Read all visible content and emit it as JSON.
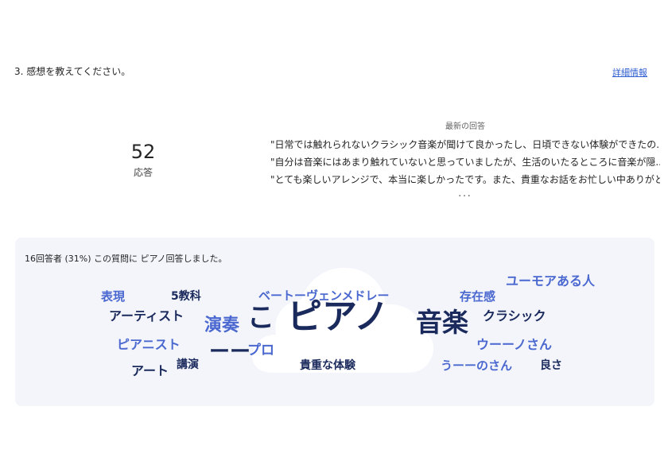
{
  "question": {
    "title": "3. 感想を教えてください。",
    "details_link": "詳細情報"
  },
  "summary": {
    "count": "52",
    "label": "応答"
  },
  "latest": {
    "heading": "最新の回答",
    "responses": [
      "\"日常では触れられないクラシック音楽が聞けて良かったし、日頃できない体験ができたの...\"",
      "\"自分は音楽にはあまり触れていないと思っていましたが、生活のいたるところに音楽が隠...\"",
      "\"とても楽しいアレンジで、本当に楽しかったです。また、貴重なお話をお忙しい中ありがと...\""
    ],
    "more": "..."
  },
  "word_cloud": {
    "caption": "16回答者 (31%) この質問に ピアノ回答しました。",
    "colors": {
      "dark": "#1b2a5c",
      "accent": "#4a68cf",
      "card": "#f3f5fb"
    },
    "words": [
      {
        "text": "表現",
        "color": "accent"
      },
      {
        "text": "5教科",
        "color": "dark"
      },
      {
        "text": "ベートーヴェンメドレー",
        "color": "accent"
      },
      {
        "text": "存在感",
        "color": "accent"
      },
      {
        "text": "ユーモアある人",
        "color": "accent"
      },
      {
        "text": "アーティスト",
        "color": "dark"
      },
      {
        "text": "演奏",
        "color": "accent"
      },
      {
        "text": "こ",
        "color": "dark"
      },
      {
        "text": "ピアノ",
        "color": "dark"
      },
      {
        "text": "音楽",
        "color": "dark"
      },
      {
        "text": "クラシック",
        "color": "dark"
      },
      {
        "text": "ピアニスト",
        "color": "accent"
      },
      {
        "text": "ーー",
        "color": "dark"
      },
      {
        "text": "プロ",
        "color": "accent"
      },
      {
        "text": "ウーーノさん",
        "color": "accent"
      },
      {
        "text": "アート",
        "color": "dark"
      },
      {
        "text": "講演",
        "color": "dark"
      },
      {
        "text": "貴重な体験",
        "color": "dark"
      },
      {
        "text": "うーーのさん",
        "color": "accent"
      },
      {
        "text": "良さ",
        "color": "dark"
      }
    ]
  }
}
